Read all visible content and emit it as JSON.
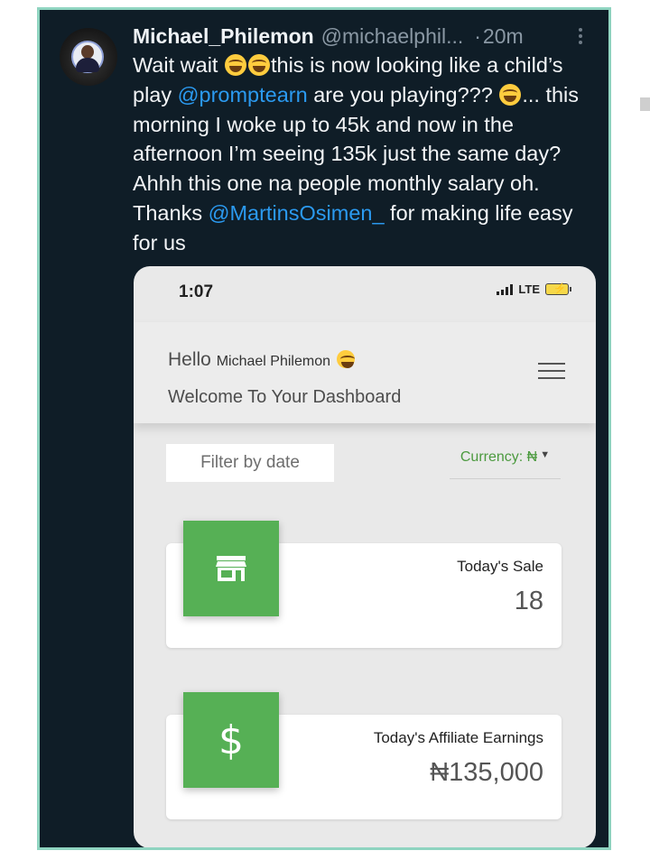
{
  "tweet": {
    "name": "Michael_Philemon",
    "handle": "@michaelphil...",
    "separator": "·",
    "time": "20m",
    "text_1": "Wait wait ",
    "text_2": "this is now looking like a child’s play ",
    "mention_1": "@promptearn",
    "text_3": " are you playing??? ",
    "text_4": "... this morning I woke up to 45k and now in the afternoon I’m seeing 135k just the same day? Ahhh this one na people monthly salary oh. Thanks ",
    "mention_2": "@MartinsOsimen_",
    "text_5": "  for making life easy for us"
  },
  "phone": {
    "status_time": "1:07",
    "network": "LTE"
  },
  "dashboard": {
    "hello": "Hello",
    "user_name": "Michael Philemon",
    "welcome": "Welcome To Your Dashboard",
    "filter_placeholder": "Filter by date",
    "currency_label": "Currency: ₦",
    "cards": [
      {
        "label": "Today's Sale",
        "value": "18",
        "icon": "store-icon"
      },
      {
        "label": "Today's Affiliate Earnings",
        "value": "₦135,000",
        "icon": "dollar-icon"
      }
    ]
  },
  "colors": {
    "tweet_bg": "#0f1d27",
    "mention": "#2b9af0",
    "accent_green": "#56b055",
    "currency_green": "#4c9a3f"
  }
}
